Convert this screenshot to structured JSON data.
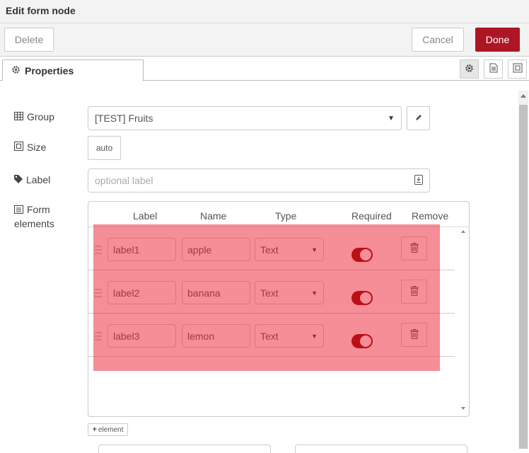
{
  "header": {
    "title": "Edit form node"
  },
  "toolbar": {
    "delete_label": "Delete",
    "cancel_label": "Cancel",
    "done_label": "Done"
  },
  "tabs": {
    "properties_label": "Properties"
  },
  "form": {
    "group": {
      "label": "Group",
      "value": "[TEST] Fruits"
    },
    "size": {
      "label": "Size",
      "value": "auto"
    },
    "label_field": {
      "label": "Label",
      "placeholder": "optional label"
    },
    "elements": {
      "label_line1": "Form",
      "label_line2": "elements",
      "columns": [
        "Label",
        "Name",
        "Type",
        "Required",
        "Remove"
      ],
      "rows": [
        {
          "label": "label1",
          "name": "apple",
          "type": "Text",
          "required": true
        },
        {
          "label": "label2",
          "name": "banana",
          "type": "Text",
          "required": true
        },
        {
          "label": "label3",
          "name": "lemon",
          "type": "Text",
          "required": true
        }
      ],
      "add_label": "element"
    }
  },
  "colors": {
    "primary": "#ad1625",
    "toggle_on": "#8b0000",
    "highlight": "#eb1e2d"
  }
}
